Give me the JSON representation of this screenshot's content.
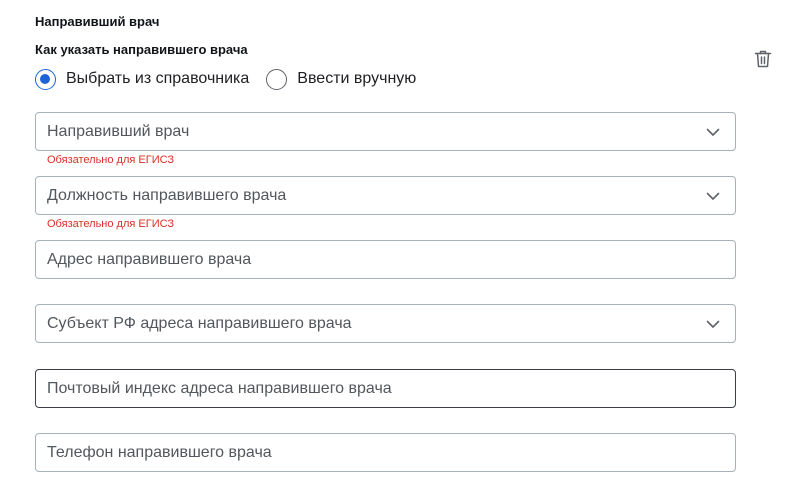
{
  "section": {
    "title": "Направивший врач"
  },
  "question": {
    "label": "Как указать направившего врача"
  },
  "radio": {
    "options": [
      {
        "label": "Выбрать из справочника",
        "checked": true
      },
      {
        "label": "Ввести вручную",
        "checked": false
      }
    ]
  },
  "actions": {
    "delete_icon": "trash-icon"
  },
  "fields": {
    "doctor": {
      "placeholder": "Направивший врач",
      "type": "select",
      "error": "Обязательно для ЕГИСЗ"
    },
    "position": {
      "placeholder": "Должность направившего врача",
      "type": "select",
      "error": "Обязательно для ЕГИСЗ"
    },
    "address": {
      "placeholder": "Адрес направившего врача",
      "type": "text"
    },
    "region": {
      "placeholder": "Субъект РФ адреса направившего врача",
      "type": "select"
    },
    "postal": {
      "placeholder": "Почтовый индекс адреса направившего врача",
      "type": "text",
      "focused": true
    },
    "phone": {
      "placeholder": "Телефон направившего врача",
      "type": "text"
    }
  },
  "colors": {
    "accent": "#1e63d6",
    "error": "#d93025",
    "border": "#a9b0b8"
  }
}
